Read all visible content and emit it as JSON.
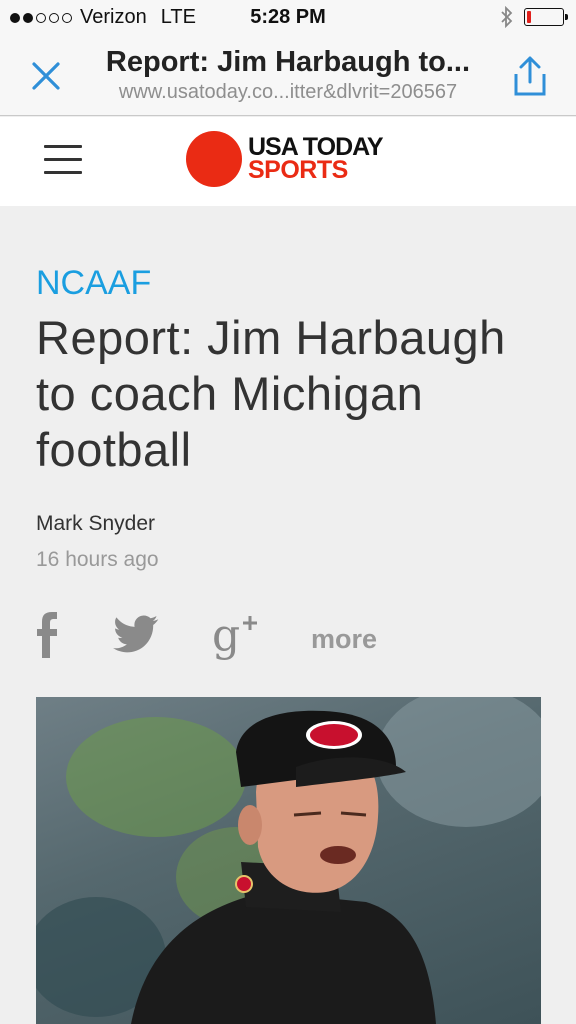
{
  "status_bar": {
    "carrier": "Verizon",
    "network": "LTE",
    "time": "5:28 PM",
    "signal_bars_filled": 2,
    "signal_bars_total": 5,
    "battery_level": 0.08,
    "battery_color": "#e0201c"
  },
  "browser": {
    "title": "Report: Jim Harbaugh to...",
    "url": "www.usatoday.co...itter&dlvrit=206567",
    "close_icon": "close-icon",
    "share_icon": "share-icon",
    "accent_color": "#2f8fd8"
  },
  "site": {
    "logo_line1": "USA TODAY",
    "logo_line2": "SPORTS",
    "brand_color": "#ea2b14",
    "menu_icon": "hamburger-menu-icon"
  },
  "article": {
    "category": "NCAAF",
    "headline": "Report: Jim Harbaugh to coach Michigan football",
    "author": "Mark Snyder",
    "timestamp": "16 hours ago",
    "share": {
      "facebook_icon": "facebook-icon",
      "twitter_icon": "twitter-icon",
      "googleplus_icon": "google-plus-icon",
      "more_label": "more"
    },
    "category_color": "#1a9ee0"
  }
}
